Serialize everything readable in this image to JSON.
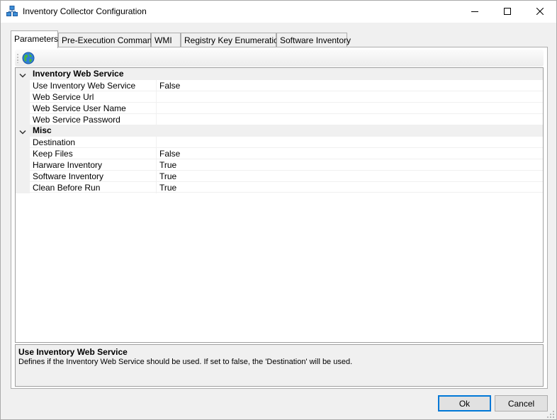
{
  "window": {
    "title": "Inventory Collector Configuration",
    "app_icon": "network-boxes-icon",
    "controls": {
      "minimize": "minimize-icon",
      "maximize": "maximize-icon",
      "close": "close-icon"
    }
  },
  "tabs": [
    {
      "label": "Parameters",
      "active": true
    },
    {
      "label": "Pre-Execution Commands",
      "active": false
    },
    {
      "label": "WMI",
      "active": false
    },
    {
      "label": "Registry Key Enumeration",
      "active": false
    },
    {
      "label": "Software Inventory",
      "active": false
    }
  ],
  "toolbar": {
    "icon": "globe-icon"
  },
  "property_grid": {
    "categories": [
      {
        "label": "Inventory Web Service",
        "expanded": true,
        "properties": [
          {
            "name": "Use Inventory Web Service",
            "value": "False"
          },
          {
            "name": "Web Service Url",
            "value": ""
          },
          {
            "name": "Web Service User Name",
            "value": ""
          },
          {
            "name": "Web Service Password",
            "value": ""
          }
        ]
      },
      {
        "label": "Misc",
        "expanded": true,
        "properties": [
          {
            "name": "Destination",
            "value": ""
          },
          {
            "name": "Keep Files",
            "value": "False"
          },
          {
            "name": "Harware Inventory",
            "value": "True"
          },
          {
            "name": "Software Inventory",
            "value": "True"
          },
          {
            "name": "Clean Before Run",
            "value": "True"
          }
        ]
      }
    ]
  },
  "help": {
    "title": "Use Inventory Web Service",
    "description": "Defines if the Inventory Web Service should be used. If set to false, the 'Destination' will be used."
  },
  "buttons": {
    "ok_label": "Ok",
    "cancel_label": "Cancel"
  },
  "colors": {
    "accent": "#0078d7",
    "category_bg": "#f0f0f0"
  }
}
